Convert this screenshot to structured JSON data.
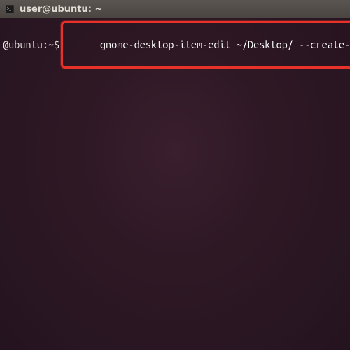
{
  "window": {
    "title": "user@ubuntu: ~"
  },
  "terminal": {
    "prompt": "@ubuntu:~$",
    "command": "gnome-desktop-item-edit ~/Desktop/ --create-new"
  }
}
